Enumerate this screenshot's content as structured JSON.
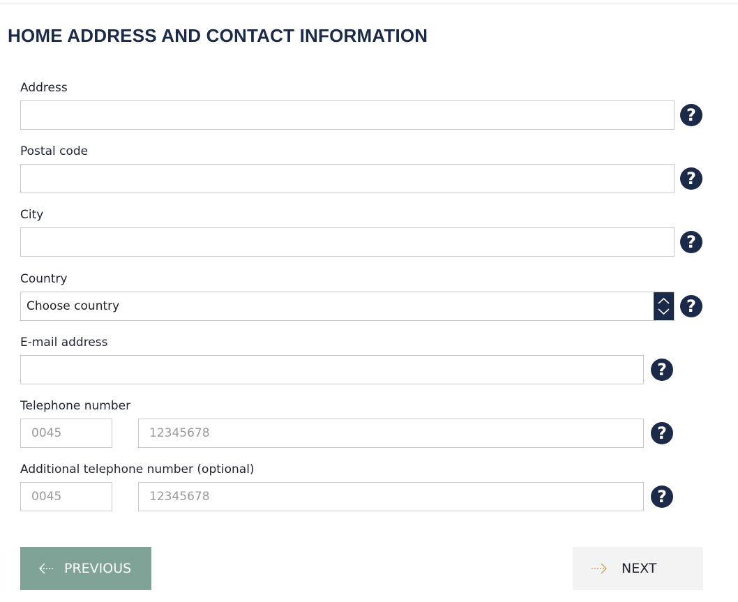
{
  "page": {
    "title": "HOME ADDRESS AND CONTACT INFORMATION"
  },
  "form": {
    "address": {
      "label": "Address",
      "value": "",
      "placeholder": ""
    },
    "postal_code": {
      "label": "Postal code",
      "value": "",
      "placeholder": ""
    },
    "city": {
      "label": "City",
      "value": "",
      "placeholder": ""
    },
    "country": {
      "label": "Country",
      "selected": "Choose country"
    },
    "email": {
      "label": "E-mail address",
      "value": "",
      "placeholder": ""
    },
    "telephone": {
      "label": "Telephone number",
      "prefix_placeholder": "0045",
      "number_placeholder": "12345678"
    },
    "additional_telephone": {
      "label": "Additional telephone number (optional)",
      "prefix_placeholder": "0045",
      "number_placeholder": "12345678"
    },
    "help_icon_glyph": "?"
  },
  "actions": {
    "previous_label": "PREVIOUS",
    "next_label": "NEXT"
  },
  "icons": {
    "help": "question-circle-icon",
    "previous": "dotted-arrow-left-icon",
    "next": "dotted-arrow-right-icon",
    "select": "chevron-up-down-icon"
  },
  "colors": {
    "primary": "#1b2a48",
    "previous_button": "#7fa497",
    "next_button": "#f3f3f3",
    "next_arrow": "#c9a35a"
  }
}
